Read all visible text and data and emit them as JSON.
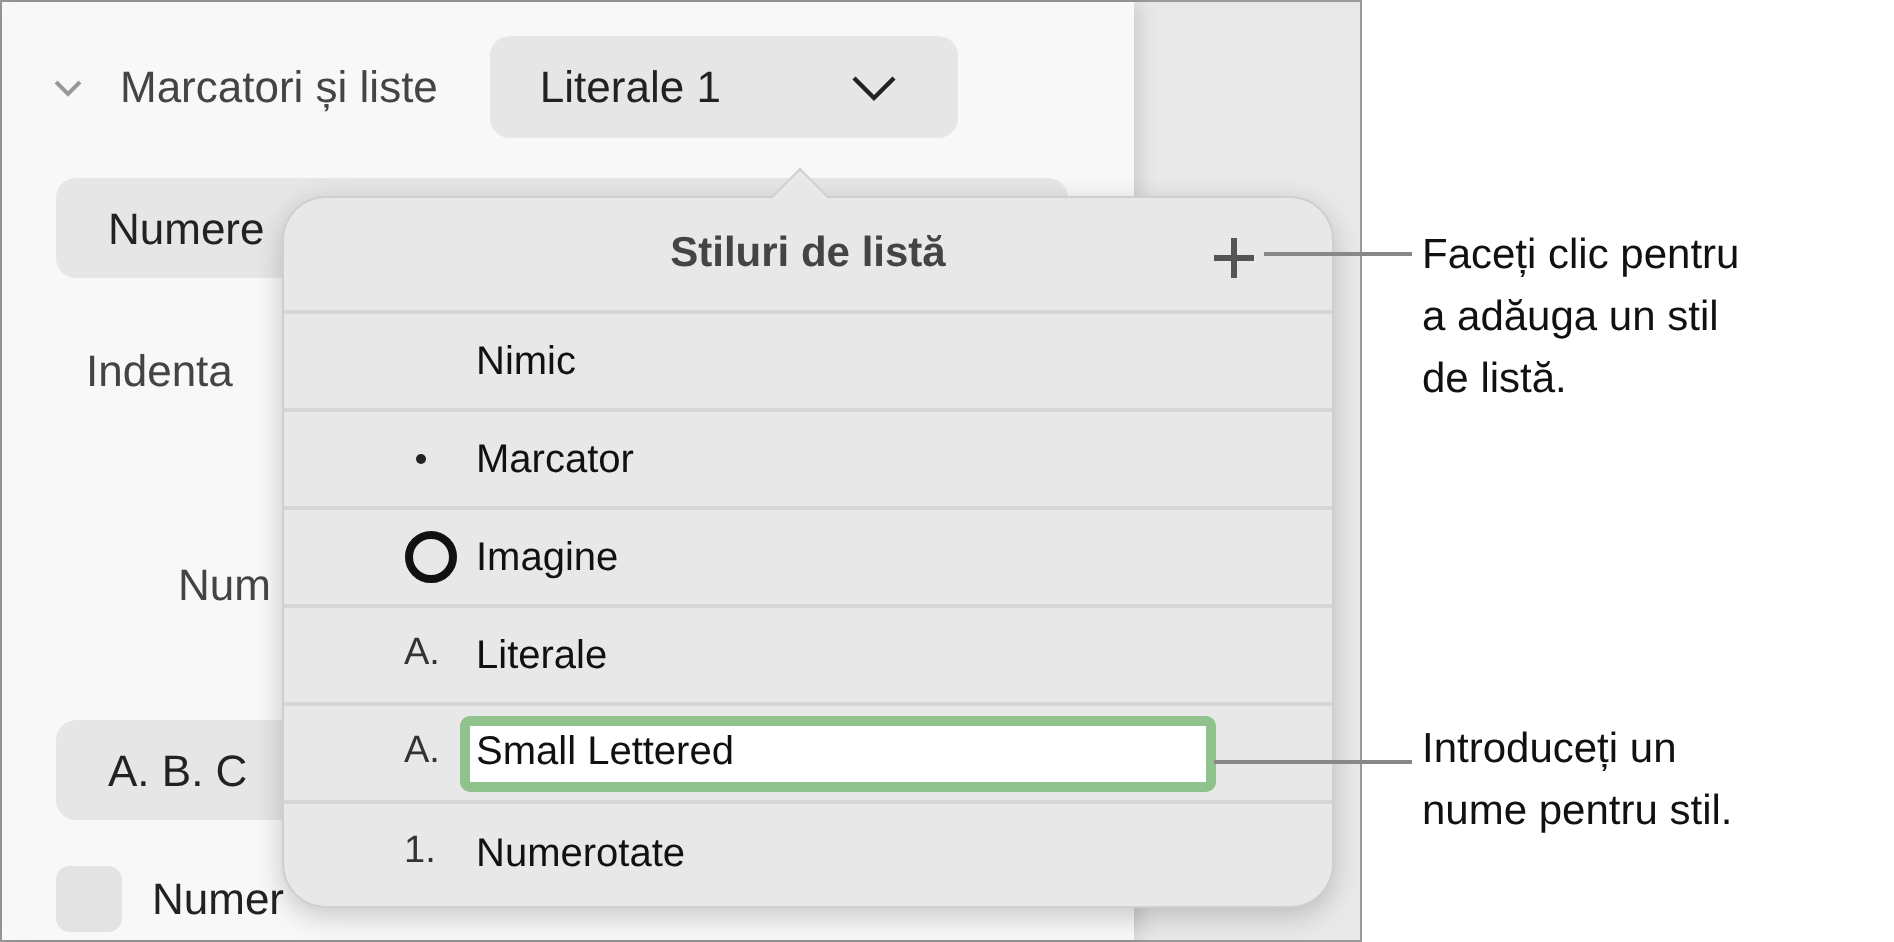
{
  "section": {
    "title": "Marcatori și liste",
    "expanded": true,
    "dropdown": {
      "value": "Literale 1"
    }
  },
  "sidebar_rows": [
    {
      "kind": "button",
      "label": "Numere"
    },
    {
      "kind": "label",
      "label": "Indenta"
    },
    {
      "kind": "label",
      "label": "Num"
    },
    {
      "kind": "button",
      "label": "A. B. C"
    },
    {
      "kind": "checkbox",
      "label": "Numer",
      "checked": false
    }
  ],
  "popover": {
    "title": "Stiluri de listă",
    "items": [
      {
        "kind": "none",
        "label": "Nimic",
        "editing": false
      },
      {
        "kind": "bullet",
        "label": "Marcator",
        "editing": false
      },
      {
        "kind": "image",
        "label": "Imagine",
        "editing": false
      },
      {
        "kind": "text",
        "marker": "A.",
        "label": "Literale",
        "editing": false
      },
      {
        "kind": "text",
        "marker": "A.",
        "label": "Small Lettered",
        "editing": true
      },
      {
        "kind": "text",
        "marker": "1.",
        "label": "Numerotate",
        "editing": false
      }
    ]
  },
  "callouts": [
    {
      "lines": [
        "Faceți clic pentru",
        "a adăuga un stil",
        "de listă."
      ]
    },
    {
      "lines": [
        "Introduceți un",
        "nume pentru stil."
      ]
    }
  ]
}
